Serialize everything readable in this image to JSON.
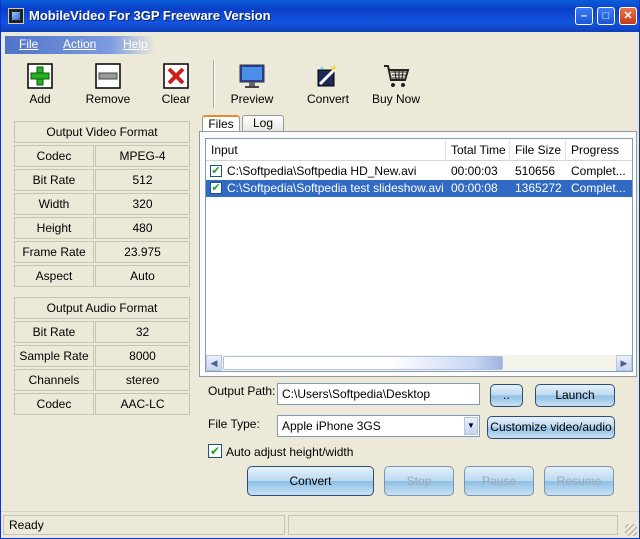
{
  "window": {
    "title": "MobileVideo For 3GP Freeware Version"
  },
  "menu": [
    {
      "label": "File"
    },
    {
      "label": "Action"
    },
    {
      "label": "Help"
    }
  ],
  "toolbar": {
    "add": "Add",
    "remove": "Remove",
    "clear": "Clear",
    "preview": "Preview",
    "convert": "Convert",
    "buy": "Buy Now"
  },
  "video_format": {
    "header": "Output Video Format",
    "rows": [
      {
        "label": "Codec",
        "value": "MPEG-4"
      },
      {
        "label": "Bit Rate",
        "value": "512"
      },
      {
        "label": "Width",
        "value": "320"
      },
      {
        "label": "Height",
        "value": "480"
      },
      {
        "label": "Frame Rate",
        "value": "23.975"
      },
      {
        "label": "Aspect",
        "value": "Auto"
      }
    ]
  },
  "audio_format": {
    "header": "Output Audio Format",
    "rows": [
      {
        "label": "Bit Rate",
        "value": "32"
      },
      {
        "label": "Sample Rate",
        "value": "8000"
      },
      {
        "label": "Channels",
        "value": "stereo"
      },
      {
        "label": "Codec",
        "value": "AAC-LC"
      }
    ]
  },
  "tabs": [
    {
      "label": "Files",
      "active": true
    },
    {
      "label": "Log",
      "active": false
    }
  ],
  "file_list": {
    "columns": [
      "Input",
      "Total Time",
      "File Size",
      "Progress"
    ],
    "rows": [
      {
        "checked": true,
        "input": "C:\\Softpedia\\Softpedia HD_New.avi",
        "time": "00:00:03",
        "size": "510656",
        "progress": "Complet...",
        "selected": false
      },
      {
        "checked": true,
        "input": "C:\\Softpedia\\Softpedia test slideshow.avi",
        "time": "00:00:08",
        "size": "1365272",
        "progress": "Complet...",
        "selected": true
      }
    ]
  },
  "output": {
    "path_label": "Output Path:",
    "path_value": "C:\\Users\\Softpedia\\Desktop",
    "browse_label": "..",
    "launch_label": "Launch",
    "filetype_label": "File Type:",
    "filetype_value": "Apple iPhone 3GS",
    "customize_label": "Customize video/audio",
    "auto_adjust_label": "Auto adjust height/width",
    "auto_adjust_checked": true
  },
  "actions": {
    "convert": "Convert",
    "stop": "Stop",
    "pause": "Pause",
    "resume": "Resume"
  },
  "status": {
    "text": "Ready"
  }
}
